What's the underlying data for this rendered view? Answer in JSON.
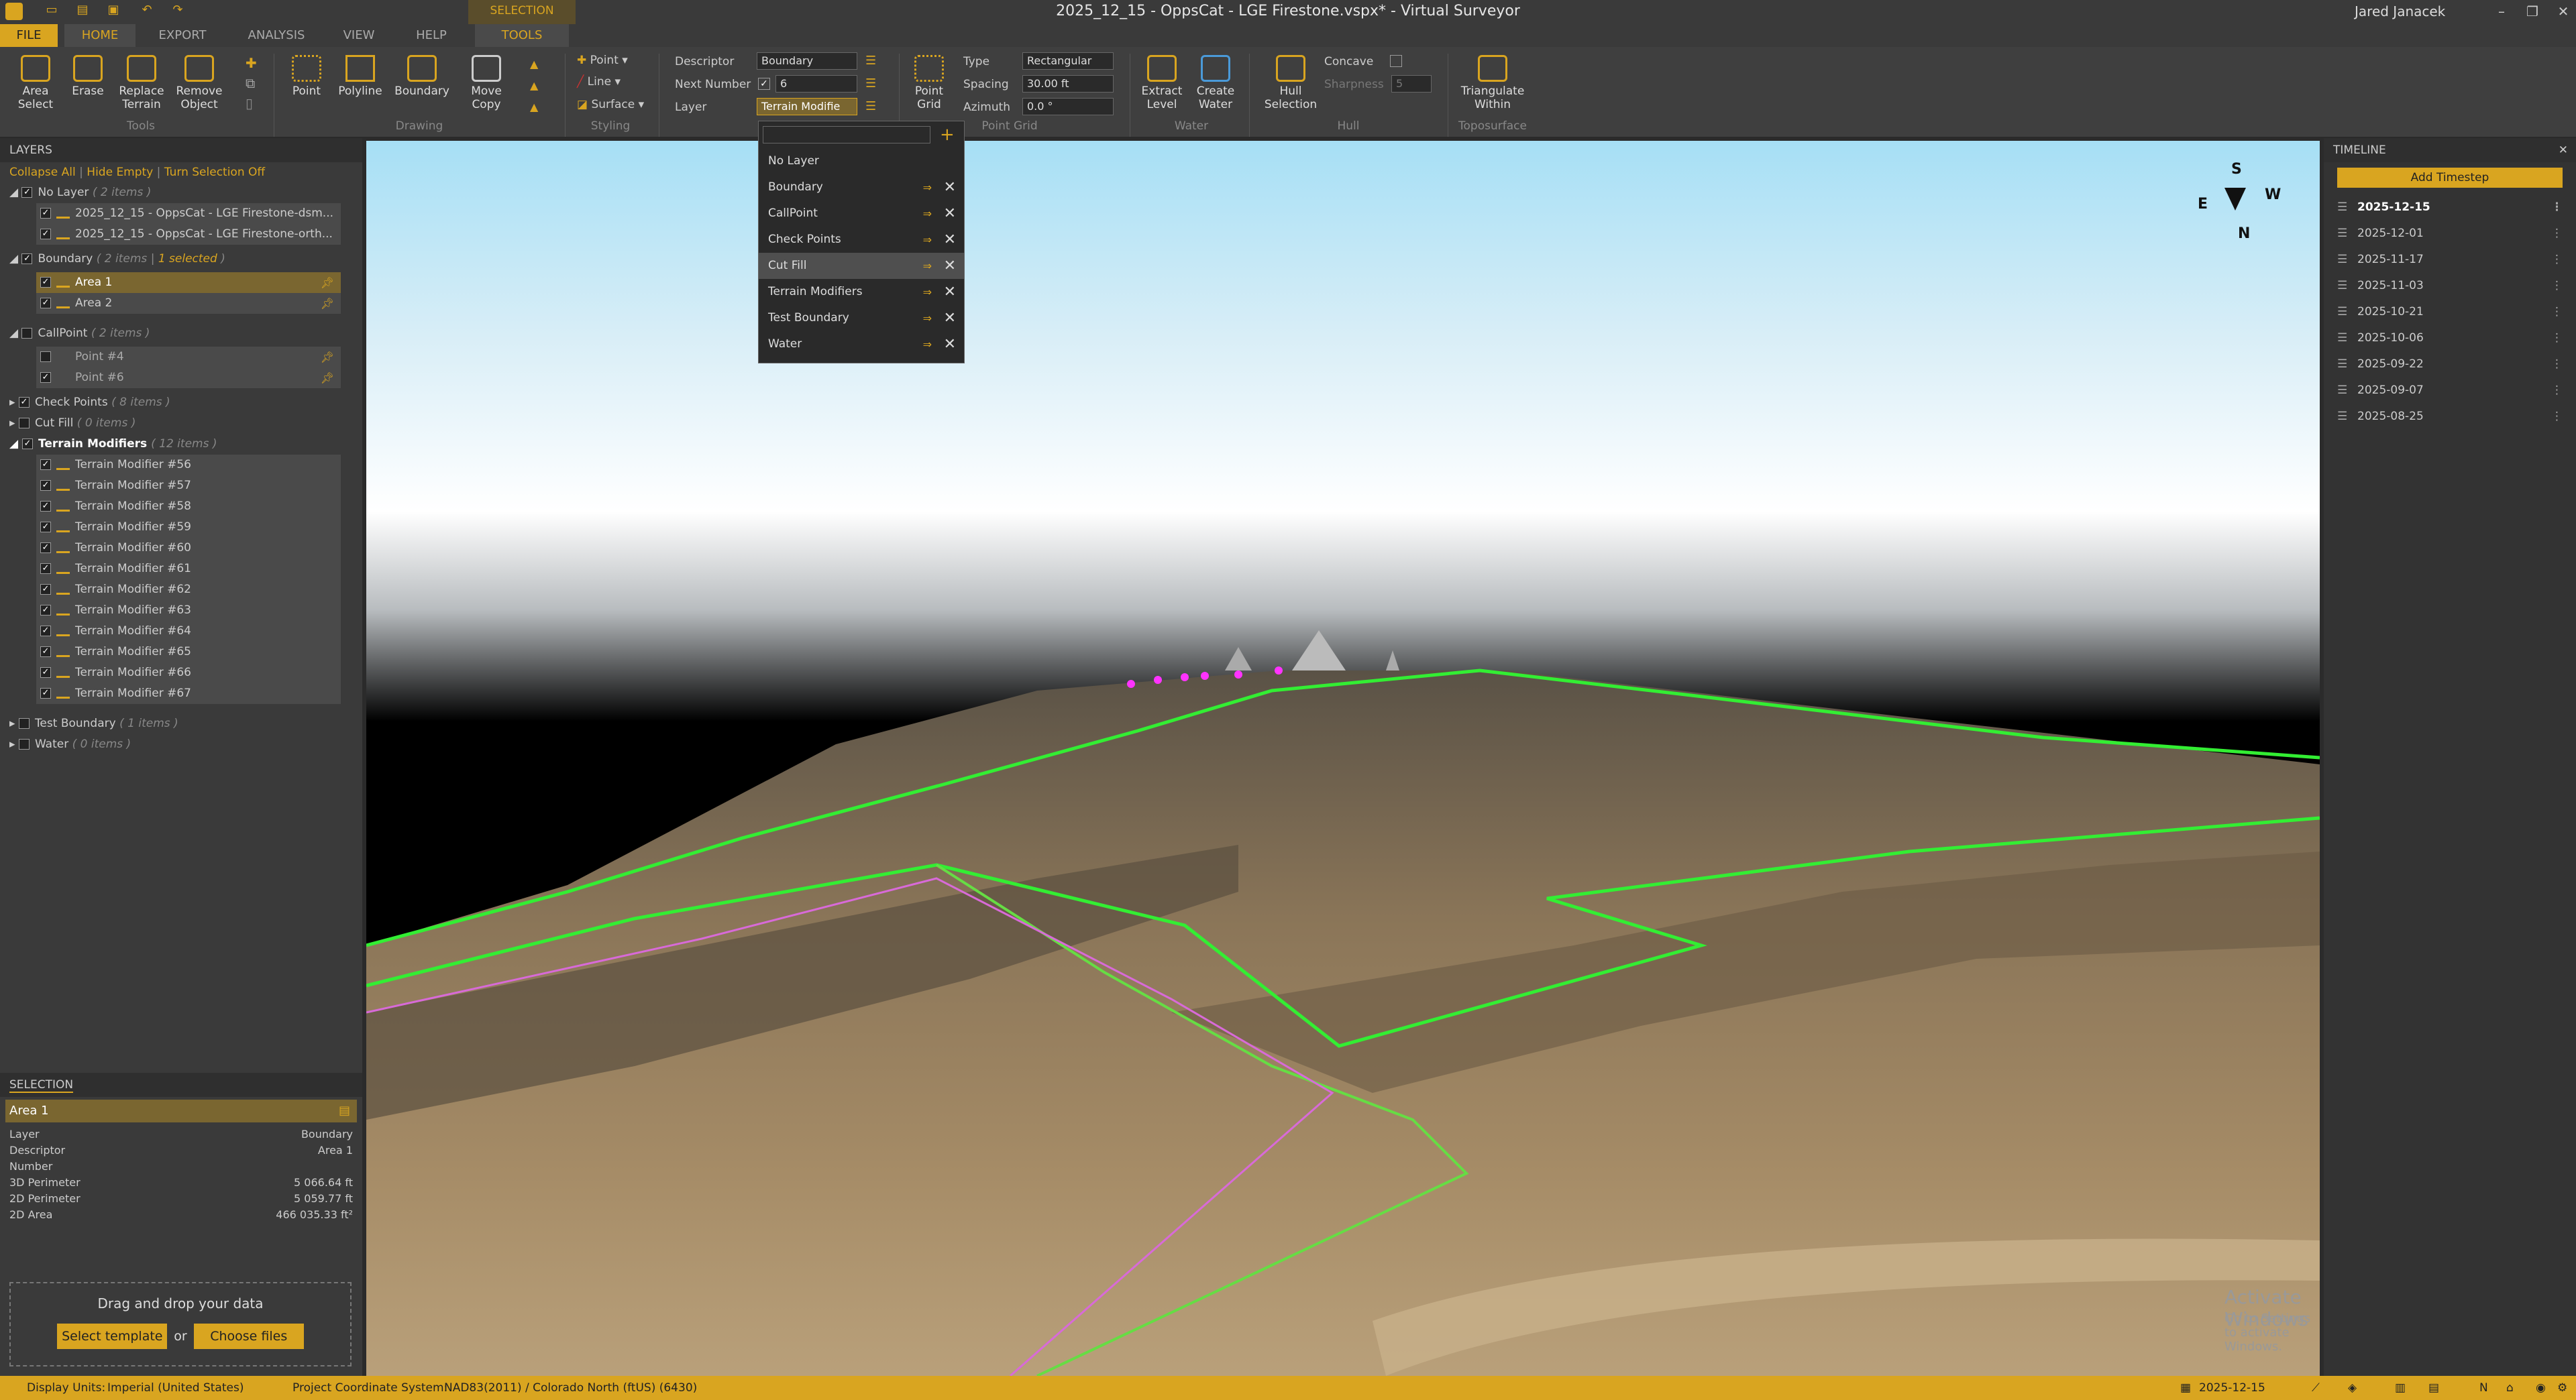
{
  "app": {
    "title": "2025_12_15 - OppsCat - LGE Firestone.vspx* - Virtual Surveyor",
    "user": "Jared Janacek"
  },
  "tabs": {
    "file": "FILE",
    "home": "HOME",
    "export": "EXPORT",
    "analysis": "ANALYSIS",
    "view": "VIEW",
    "help": "HELP",
    "selection": "SELECTION",
    "tools": "TOOLS"
  },
  "ribbon": {
    "tools": {
      "area_select": "Area Select",
      "erase": "Erase",
      "replace_terrain": "Replace Terrain",
      "remove_object": "Remove Object",
      "group": "Tools"
    },
    "drawing": {
      "point": "Point",
      "polyline": "Polyline",
      "boundary": "Boundary",
      "move_copy": "Move Copy",
      "group": "Drawing"
    },
    "styling": {
      "point": "Point",
      "line": "Line",
      "surface": "Surface",
      "group": "Styling"
    },
    "fields": {
      "descriptor_label": "Descriptor",
      "descriptor_value": "Boundary",
      "next_number_label": "Next Number",
      "next_number_value": "6",
      "layer_label": "Layer",
      "layer_value": "Terrain Modifie"
    },
    "point_grid": {
      "button": "Point Grid",
      "type_label": "Type",
      "type_value": "Rectangular",
      "spacing_label": "Spacing",
      "spacing_value": "30.00 ft",
      "azimuth_label": "Azimuth",
      "azimuth_value": "0.0 °",
      "group": "Point Grid"
    },
    "water": {
      "extract_level": "Extract Level",
      "create_water": "Create Water",
      "group": "Water"
    },
    "hull": {
      "hull_selection": "Hull Selection",
      "concave": "Concave",
      "sharpness": "Sharpness",
      "sharpness_value": "5",
      "group": "Hull"
    },
    "topo": {
      "triangulate": "Triangulate Within",
      "group": "Toposurface"
    }
  },
  "layers": {
    "header": "LAYERS",
    "collapse_all": "Collapse All",
    "hide_empty": "Hide Empty",
    "turn_selection_off": "Turn Selection Off",
    "no_layer": "No Layer",
    "no_layer_count": "( 2 items )",
    "no_layer_items": [
      "2025_12_15 - OppsCat - LGE Firestone-dsm...",
      "2025_12_15 - OppsCat - LGE Firestone-orth..."
    ],
    "boundary": "Boundary",
    "boundary_count": "( 2 items |",
    "boundary_selected": "1 selected",
    "boundary_items": [
      "Area 1",
      "Area 2"
    ],
    "callpoint": "CallPoint",
    "callpoint_count": "( 2 items )",
    "callpoint_items": [
      "Point #4",
      "Point #6"
    ],
    "check_points": "Check Points",
    "check_points_count": "( 8 items )",
    "cut_fill": "Cut Fill",
    "cut_fill_count": "( 0 items )",
    "terrain_modifiers": "Terrain Modifiers",
    "terrain_modifiers_count": "( 12 items )",
    "terrain_items": [
      "Terrain Modifier #56",
      "Terrain Modifier #57",
      "Terrain Modifier #58",
      "Terrain Modifier #59",
      "Terrain Modifier #60",
      "Terrain Modifier #61",
      "Terrain Modifier #62",
      "Terrain Modifier #63",
      "Terrain Modifier #64",
      "Terrain Modifier #65",
      "Terrain Modifier #66",
      "Terrain Modifier #67"
    ],
    "test_boundary": "Test Boundary",
    "test_boundary_count": "( 1 items )",
    "water": "Water",
    "water_count": "( 0 items )"
  },
  "selection": {
    "header": "SELECTION",
    "name": "Area 1",
    "props": [
      [
        "Layer",
        "Boundary"
      ],
      [
        "Descriptor",
        "Area 1"
      ],
      [
        "Number",
        ""
      ],
      [
        "3D Perimeter",
        "5 066.64 ft"
      ],
      [
        "2D Perimeter",
        "5 059.77 ft"
      ],
      [
        "2D Area",
        "466 035.33 ft²"
      ]
    ]
  },
  "dropzone": {
    "text": "Drag and drop your data",
    "select_template": "Select template",
    "or": "or",
    "choose_files": "Choose files"
  },
  "dropdown": {
    "items": [
      "No Layer",
      "Boundary",
      "CallPoint",
      "Check Points",
      "Cut Fill",
      "Terrain Modifiers",
      "Test Boundary",
      "Water"
    ]
  },
  "compass": {
    "s": "S",
    "w": "W",
    "e": "E",
    "n": "N"
  },
  "watermark": {
    "line1": "Activate Windows",
    "line2": "Go to Settings to activate Windows."
  },
  "timeline": {
    "header": "TIMELINE",
    "add": "Add Timestep",
    "dates": [
      "2025-12-15",
      "2025-12-01",
      "2025-11-17",
      "2025-11-03",
      "2025-10-21",
      "2025-10-06",
      "2025-09-22",
      "2025-09-07",
      "2025-08-25"
    ]
  },
  "status": {
    "display_units_label": "Display Units:",
    "display_units": "Imperial (United States)",
    "crs_label": "Project Coordinate System:",
    "crs": "NAD83(2011) / Colorado North (ftUS) (6430)",
    "date": "2025-12-15"
  }
}
